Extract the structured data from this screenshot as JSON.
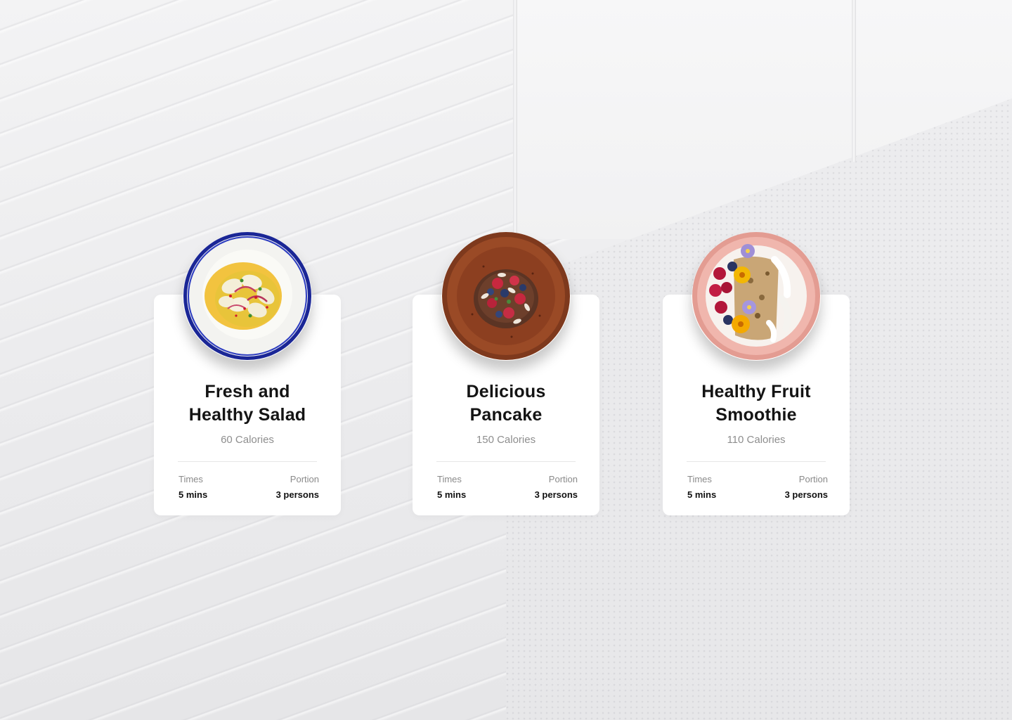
{
  "cards": [
    {
      "title": "Fresh and Healthy Salad",
      "calories": "60 Calories",
      "times_label": "Times",
      "times_value": "5 mins",
      "portion_label": "Portion",
      "portion_value": "3 persons",
      "dish": "salad-bowl-image"
    },
    {
      "title": "Delicious Pancake",
      "calories": "150 Calories",
      "times_label": "Times",
      "times_value": "5 mins",
      "portion_label": "Portion",
      "portion_value": "3 persons",
      "dish": "pancake-plate-image"
    },
    {
      "title": "Healthy Fruit Smoothie",
      "calories": "110 Calories",
      "times_label": "Times",
      "times_value": "5 mins",
      "portion_label": "Portion",
      "portion_value": "3 persons",
      "dish": "smoothie-bowl-image"
    }
  ],
  "colors": {
    "title": "#141414",
    "muted": "#8e8e8e",
    "card": "#ffffff",
    "salad_rim": "#1e2a9c",
    "pancake_plate": "#8a3f22",
    "smoothie_bowl": "#e8a49c"
  }
}
